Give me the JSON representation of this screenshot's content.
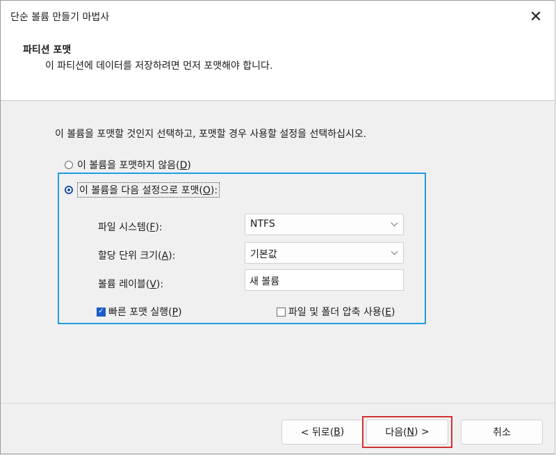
{
  "window": {
    "title": "단순 볼륨 만들기 마법사"
  },
  "header": {
    "title": "파티션 포맷",
    "subtitle": "이 파티션에 데이터를 저장하려면 먼저 포맷해야 합니다."
  },
  "instruction": "이 볼륨을 포맷할 것인지 선택하고, 포맷할 경우 사용할 설정을 선택하십시오.",
  "options": {
    "no_format": {
      "label": "이 볼륨을 포맷하지 않음(",
      "key": "D",
      "end": ")",
      "selected": false
    },
    "format": {
      "label": "이 볼륨을 다음 설정으로 포맷(",
      "key": "O",
      "end": "):",
      "selected": true
    }
  },
  "settings": {
    "fs": {
      "label": "파일 시스템(",
      "key": "F",
      "end": "):",
      "value": "NTFS"
    },
    "alloc": {
      "label": "할당 단위 크기(",
      "key": "A",
      "end": "):",
      "value": "기본값"
    },
    "vol_label": {
      "label": "볼륨 레이블(",
      "key": "V",
      "end": "):",
      "value": "새 볼륨"
    },
    "quick": {
      "label": "빠른 포맷 실행(",
      "key": "P",
      "end": ")",
      "checked": true
    },
    "compress": {
      "label": "파일 및 폴더 압축 사용(",
      "key": "E",
      "end": ")",
      "checked": false
    }
  },
  "buttons": {
    "back": {
      "label": "< 뒤로(",
      "key": "B",
      "end": ")"
    },
    "next": {
      "label": "다음(",
      "key": "N",
      "end": ") >"
    },
    "cancel": {
      "label": "취소"
    }
  },
  "colors": {
    "accent": "#1f9ce0",
    "highlight": "#d32f2f",
    "checkbox": "#1a5cc8"
  }
}
